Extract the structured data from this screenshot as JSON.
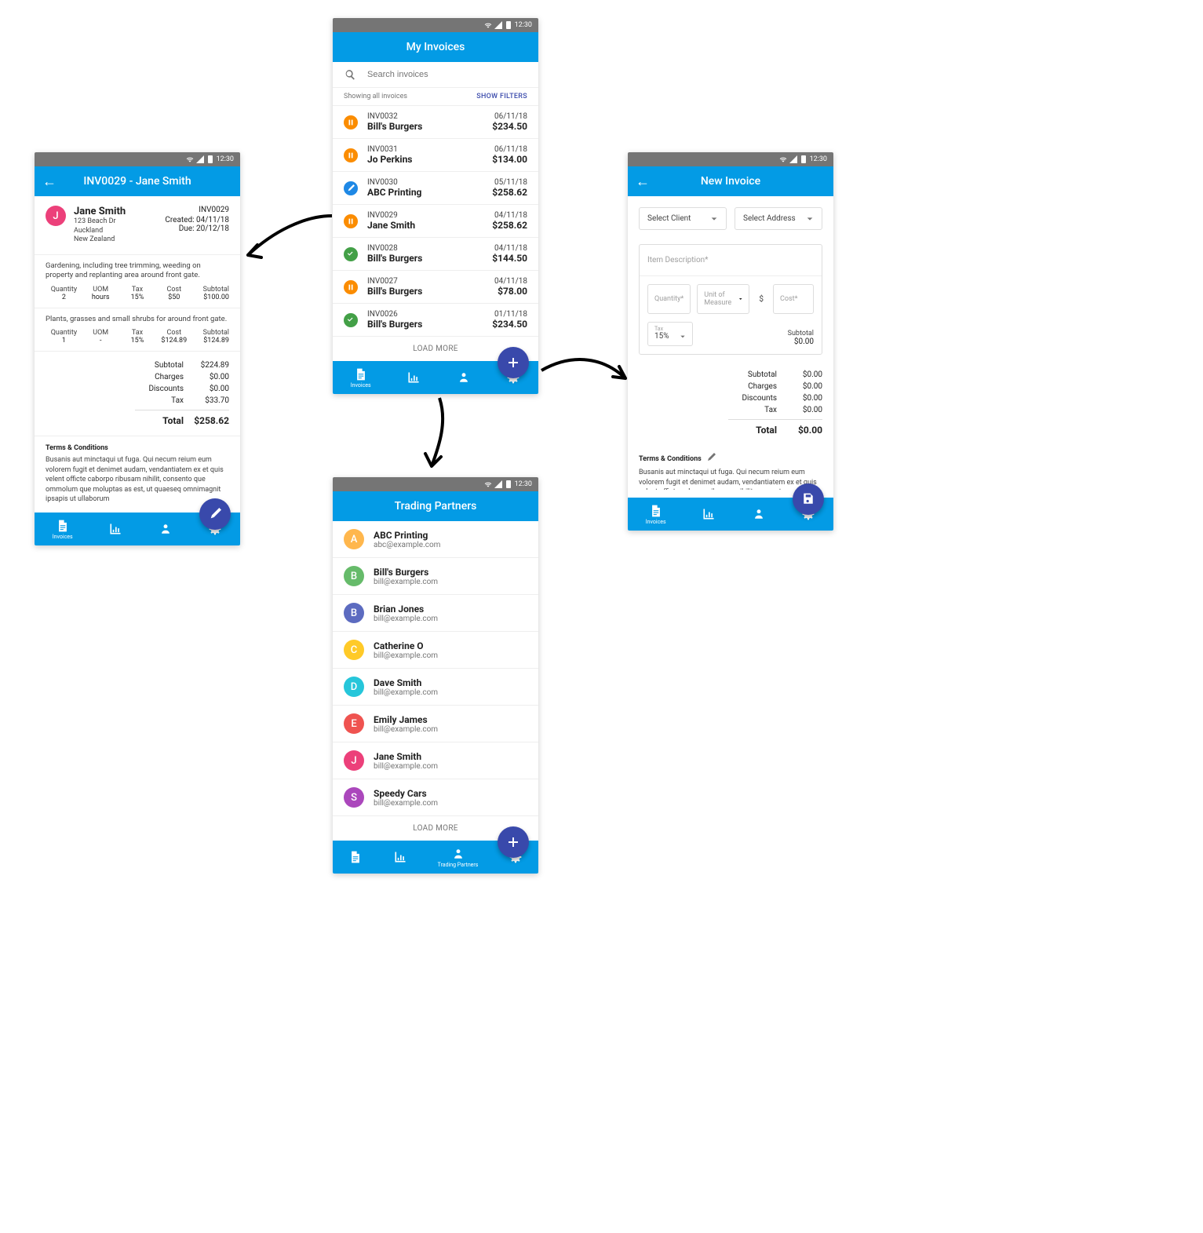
{
  "statusbar_time": "12:30",
  "my_invoices": {
    "title": "My Invoices",
    "search_placeholder": "Search invoices",
    "showing": "Showing all invoices",
    "show_filters": "SHOW FILTERS",
    "load_more": "LOAD MORE",
    "nav_label": "Invoices",
    "items": [
      {
        "code": "INV0032",
        "name": "Bill's Burgers",
        "date": "06/11/18",
        "amt": "$234.50",
        "status": "pause",
        "color": "#fb8c00"
      },
      {
        "code": "INV0031",
        "name": "Jo Perkins",
        "date": "06/11/18",
        "amt": "$134.00",
        "status": "pause",
        "color": "#fb8c00"
      },
      {
        "code": "INV0030",
        "name": "ABC Printing",
        "date": "05/11/18",
        "amt": "$258.62",
        "status": "edit",
        "color": "#1e88e5"
      },
      {
        "code": "INV0029",
        "name": "Jane Smith",
        "date": "04/11/18",
        "amt": "$258.62",
        "status": "pause",
        "color": "#fb8c00"
      },
      {
        "code": "INV0028",
        "name": "Bill's Burgers",
        "date": "04/11/18",
        "amt": "$144.50",
        "status": "done",
        "color": "#43a047"
      },
      {
        "code": "INV0027",
        "name": "Bill's Burgers",
        "date": "04/11/18",
        "amt": "$78.00",
        "status": "pause",
        "color": "#fb8c00"
      },
      {
        "code": "INV0026",
        "name": "Bill's Burgers",
        "date": "01/11/18",
        "amt": "$234.50",
        "status": "done",
        "color": "#43a047"
      }
    ]
  },
  "detail": {
    "title": "INV0029 - Jane Smith",
    "avatar_letter": "J",
    "avatar_color": "#ec407a",
    "client_name": "Jane Smith",
    "addr1": "123 Beach Dr",
    "addr2": "Auckland",
    "addr3": "New Zealand",
    "inv_no": "INV0029",
    "created": "Created: 04/11/18",
    "due": "Due: 20/12/18",
    "lines": [
      {
        "desc": "Gardening, including tree trimming, weeding on property and replanting area around front gate.",
        "qty": "2",
        "uom": "hours",
        "tax": "15%",
        "cost": "$50",
        "sub": "$100.00"
      },
      {
        "desc": "Plants, grasses and small shrubs for around front gate.",
        "qty": "1",
        "uom": "-",
        "tax": "15%",
        "cost": "$124.89",
        "sub": "$124.89"
      }
    ],
    "headers": {
      "qty": "Quantity",
      "uom": "UOM",
      "tax": "Tax",
      "cost": "Cost",
      "sub": "Subtotal"
    },
    "totals": {
      "subtotal_lbl": "Subtotal",
      "subtotal": "$224.89",
      "charges_lbl": "Charges",
      "charges": "$0.00",
      "discounts_lbl": "Discounts",
      "discounts": "$0.00",
      "tax_lbl": "Tax",
      "tax": "$33.70",
      "total_lbl": "Total",
      "total": "$258.62"
    },
    "terms_hd": "Terms & Conditions",
    "terms_txt": "Busanis aut minctaqui ut fuga. Qui necum reium eum volorem fugit et denimet audam, vendantiatem ex et quis velent officte caborpo ribusam nihilit, consento que ommolum que moluptas as est, ut quaeseq omnimagnit ipsapis ut ullaborum",
    "nav_label": "Invoices"
  },
  "partners": {
    "title": "Trading Partners",
    "load_more": "LOAD MORE",
    "nav_label": "Trading Partners",
    "items": [
      {
        "letter": "A",
        "name": "ABC Printing",
        "email": "abc@example.com",
        "color": "#ffb74d"
      },
      {
        "letter": "B",
        "name": "Bill's Burgers",
        "email": "bill@example.com",
        "color": "#66bb6a"
      },
      {
        "letter": "B",
        "name": "Brian Jones",
        "email": "bill@example.com",
        "color": "#5c6bc0"
      },
      {
        "letter": "C",
        "name": "Catherine O",
        "email": "bill@example.com",
        "color": "#ffca28"
      },
      {
        "letter": "D",
        "name": "Dave Smith",
        "email": "bill@example.com",
        "color": "#26c6da"
      },
      {
        "letter": "E",
        "name": "Emily James",
        "email": "bill@example.com",
        "color": "#ef5350"
      },
      {
        "letter": "J",
        "name": "Jane Smith",
        "email": "bill@example.com",
        "color": "#ec407a"
      },
      {
        "letter": "S",
        "name": "Speedy Cars",
        "email": "bill@example.com",
        "color": "#ab47bc"
      }
    ]
  },
  "new_inv": {
    "title": "New Invoice",
    "select_client": "Select Client",
    "select_address": "Select Address",
    "item_desc": "Item Description*",
    "qty": "Quantity*",
    "uom": "Unit of Measure",
    "cost": "Cost*",
    "dollar": "$",
    "tax_lbl": "Tax",
    "tax_val": "15%",
    "subtotal_lbl": "Subtotal",
    "subtotal_val": "$0.00",
    "totals": {
      "subtotal_lbl": "Subtotal",
      "subtotal": "$0.00",
      "charges_lbl": "Charges",
      "charges": "$0.00",
      "discounts_lbl": "Discounts",
      "discounts": "$0.00",
      "tax_lbl": "Tax",
      "tax": "$0.00",
      "total_lbl": "Total",
      "total": "$0.00"
    },
    "terms_hd": "Terms & Conditions",
    "terms_txt": "Busanis aut minctaqui ut fuga. Qui necum reium eum volorem fugit et denimet audam, vendantiatem ex et quis velent officte caborpo ribusam nihilit, consento que ommolum",
    "nav_label": "Invoices"
  }
}
